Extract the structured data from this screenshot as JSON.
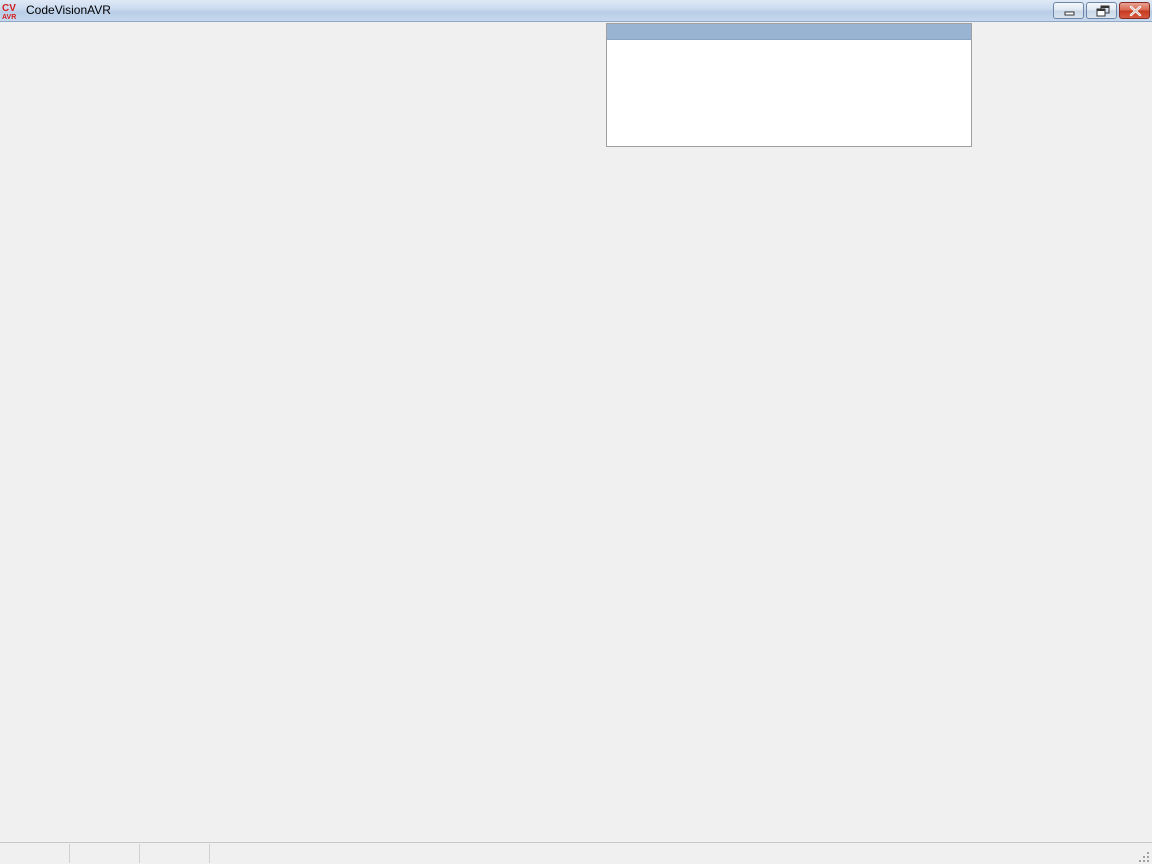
{
  "window": {
    "title": "CodeVisionAVR",
    "icon": "codevisionavr-logo-icon",
    "controls": {
      "minimize_icon": "minimize-icon",
      "restore_icon": "restore-icon",
      "close_icon": "close-icon"
    }
  },
  "floating_panel": {
    "header_color": "#99b3d3"
  },
  "statusbar": {
    "panels": [
      "",
      "",
      "",
      ""
    ]
  },
  "colors": {
    "workspace": "#f0f0f0",
    "close_button": "#c4391f",
    "logo_red": "#d42020"
  }
}
